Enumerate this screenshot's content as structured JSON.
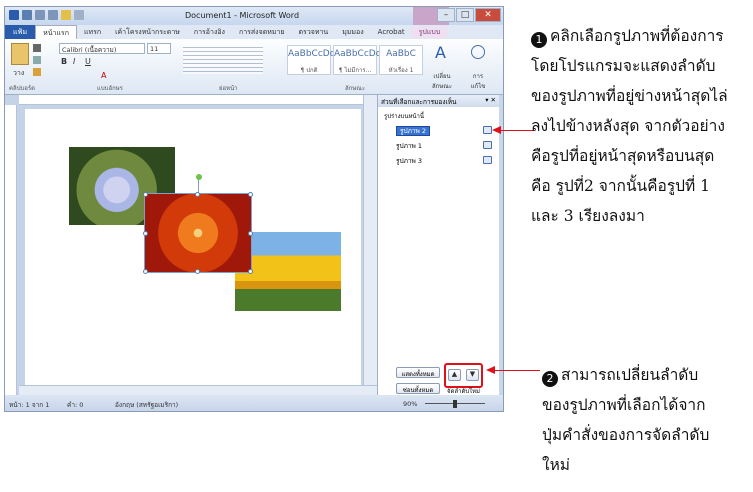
{
  "window": {
    "title": "Document1 - Microsoft Word",
    "file_tab": "แฟ้ม",
    "tabs": [
      "หน้าแรก",
      "แทรก",
      "เค้าโครงหน้ากระดาษ",
      "การอ้างอิง",
      "การส่งจดหมาย",
      "ตรวจทาน",
      "มุมมอง",
      "Acrobat",
      "รูปแบบ"
    ],
    "controls": {
      "minimize": "–",
      "maximize": "□",
      "close": "✕"
    }
  },
  "ribbon": {
    "paste_label": "วาง",
    "font_name": "Calibri (เนื้อความ)",
    "font_size": "11",
    "groups": [
      "คลิปบอร์ด",
      "แบบอักษร",
      "ย่อหน้า",
      "ลักษณะ"
    ],
    "styles": [
      {
        "sample": "AaBbCcDc",
        "name": "¶ ปกติ"
      },
      {
        "sample": "AaBbCcDc",
        "name": "¶ ไม่มีการ..."
      },
      {
        "sample": "AaBbC",
        "name": "หัวเรื่อง 1"
      }
    ],
    "change_styles": "เปลี่ยน ลักษณะ",
    "editing": "การ แก้ไข"
  },
  "pane": {
    "title": "ส่วนที่เลือกและการมองเห็น",
    "subtitle": "รูปร่างบนหน้านี้",
    "items": [
      "รูปภาพ 2",
      "รูปภาพ 1",
      "รูปภาพ 3"
    ],
    "show_all": "แสดงทั้งหมด",
    "hide_all": "ซ่อนทั้งหมด",
    "reorder_label": "จัดลำดับใหม่"
  },
  "status": {
    "page": "หน้า: 1 จาก 1",
    "words": "คำ: 0",
    "language": "อังกฤษ (สหรัฐอเมริกา)",
    "zoom": "90%"
  },
  "annotation1": {
    "bullet": "1",
    "lines": [
      "คลิกเลือกรูปภาพที่ต้องการ",
      "โดยโปรแกรมจะแสดงลำดับ",
      "ของรูปภาพที่อยู่ข่างหน้าสุดไล่",
      "ลงไปข้างหลังสุด จากตัวอย่าง",
      "คือรูปที่อยู่หน้าสุดหรือบนสุด",
      "คือ รูปที่2 จากนั้นคือรูปที่ 1",
      "และ 3 เรียงลงมา"
    ]
  },
  "annotation2": {
    "bullet": "2",
    "lines": [
      "สามารถเปลี่ยนลำดับ",
      "ของรูปภาพที่เลือกได้จาก",
      "ปุ่มคำสั่งของการจัดลำดับ",
      "ใหม่"
    ]
  },
  "colors": {
    "annotation_red": "#e0101a",
    "selected_item": "#3873d0"
  }
}
